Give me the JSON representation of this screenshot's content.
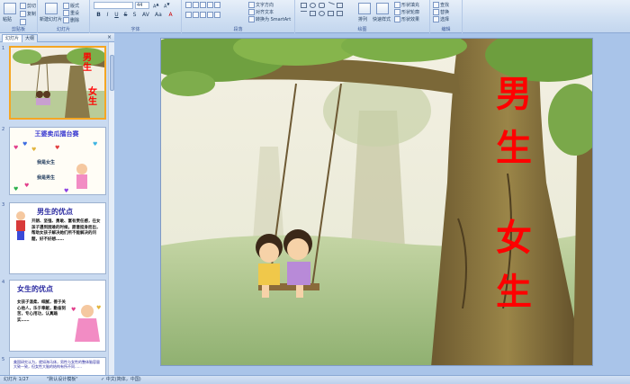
{
  "ribbon": {
    "clipboard": {
      "paste": "粘贴",
      "cut": "剪切",
      "copy": "复制",
      "label": "剪贴板"
    },
    "slides": {
      "new_slide": "新建幻灯片",
      "layout": "版式",
      "reset": "重设",
      "delete": "删除",
      "label": "幻灯片"
    },
    "font": {
      "size": "44",
      "label": "字体"
    },
    "paragraph": {
      "text_direction": "文字方向",
      "align_text": "对齐文本",
      "smartart": "转换为 SmartArt",
      "label": "段落"
    },
    "drawing": {
      "arrange": "排列",
      "quick_styles": "快速样式",
      "shape_fill": "形状填充",
      "shape_outline": "形状轮廓",
      "shape_effects": "形状效果",
      "label": "绘图"
    },
    "editing": {
      "find": "查找",
      "replace": "替换",
      "select": "选择",
      "label": "编辑"
    }
  },
  "panel": {
    "tab_slides": "幻灯片",
    "tab_outline": "大纲",
    "close": "×",
    "thumbs": [
      {
        "num": "1",
        "text1": "男",
        "text2": "生",
        "text3": "女",
        "text4": "生"
      },
      {
        "num": "2",
        "title": "王婆卖瓜擂台赛",
        "line1": "我是女生",
        "line2": "我是男生"
      },
      {
        "num": "3",
        "title": "男生的优点",
        "body": "开朗、坚强、勇敢、富有责任感，在女孩子遇到困难的时候，愿意挺身而出，帮助女孩子解决她们所不能解决的问题，好不好想……"
      },
      {
        "num": "4",
        "title": "女生的优点",
        "body": "女孩子温柔、细腻，善于关心他人，乐于奉献，勤奋刻苦，专心用功，认真踏实……"
      },
      {
        "num": "5",
        "body": "美国研究认为，就如海马体，男性与女性的整体脑容量大致一致，但女性大脑的结构有所不同……"
      }
    ]
  },
  "slide": {
    "left_top": "男",
    "left_bottom": "生",
    "right_top": "女",
    "right_bottom": "生"
  },
  "status": {
    "slide_count": "幻灯片 1/27",
    "theme": "\"默认设计模板\"",
    "language": "中文(简体，中国)"
  }
}
